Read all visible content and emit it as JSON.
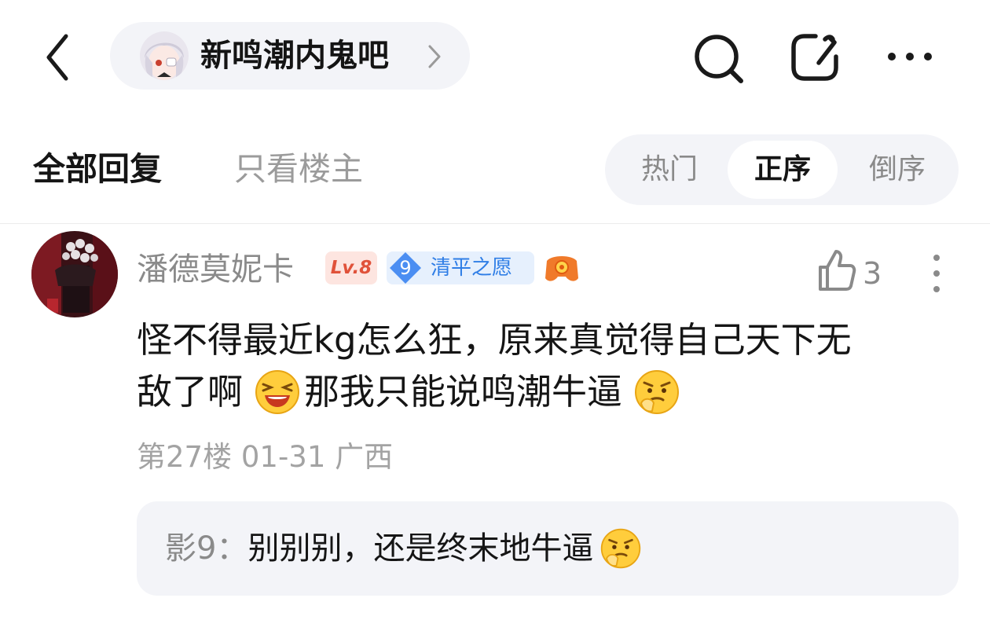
{
  "header": {
    "forum_name": "新鸣潮内鬼吧",
    "icons": {
      "back": "chevron-left-icon",
      "forum_arrow": "chevron-right-icon",
      "search": "search-icon",
      "share": "share-icon",
      "more": "more-horizontal-icon"
    }
  },
  "tabs": {
    "all_replies": "全部回复",
    "only_op": "只看楼主",
    "sort": {
      "hot": "热门",
      "ascending": "正序",
      "descending": "倒序",
      "selected": "正序"
    }
  },
  "post": {
    "username": "潘德莫妮卡",
    "level_badge": "Lv.8",
    "fan_badge": {
      "level": "9",
      "name": "清平之愿"
    },
    "likes": "3",
    "content_line1": "怪不得最近kg怎么狂，原来真觉得自己天下无",
    "content_line2_a": "敌了啊",
    "content_line2_b": "那我只能说鸣潮牛逼",
    "floor": "第27楼",
    "date": "01-31",
    "location": "广西",
    "emojis": [
      "laughing-emoji",
      "thinking-emoji"
    ],
    "colors": {
      "level_badge_bg": "#fde5e0",
      "level_badge_text": "#e0523a",
      "fan_badge_bg": "#e6f0fd",
      "fan_badge_text": "#2f7ee6"
    }
  },
  "sub_reply": {
    "author": "影9",
    "separator": "：",
    "text": "别别别，还是终末地牛逼",
    "emoji": "thinking-emoji"
  }
}
